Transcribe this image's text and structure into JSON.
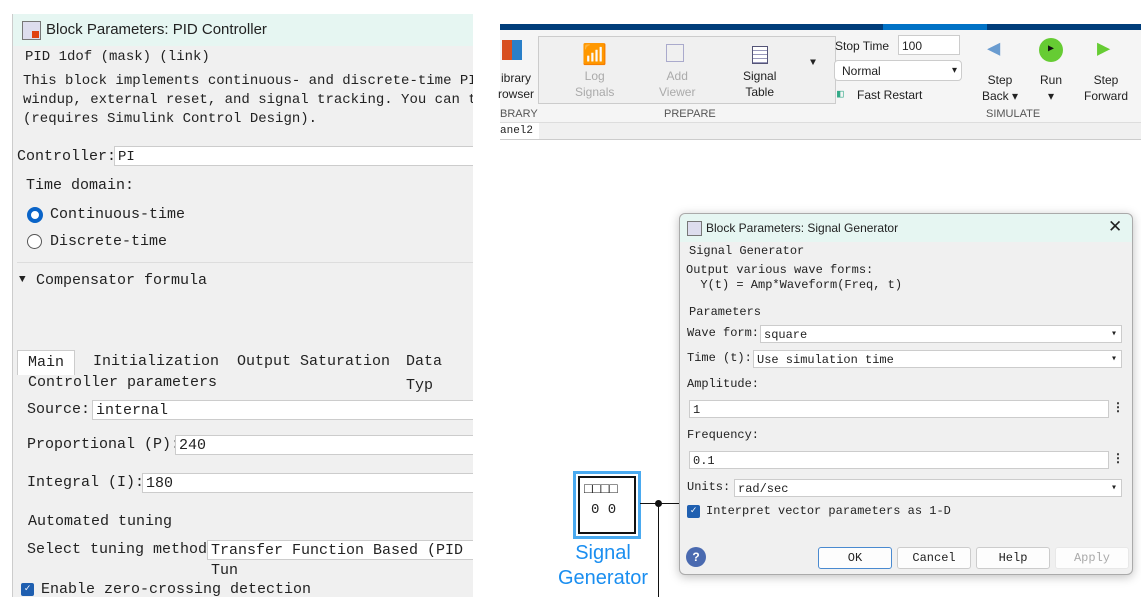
{
  "pid": {
    "title": "Block Parameters: PID Controller",
    "mask": "PID 1dof (mask) (link)",
    "desc": [
      "This block implements continuous- and discrete-time PID",
      "windup, external reset, and signal tracking. You can tu",
      "(requires Simulink Control Design)."
    ],
    "controller_label": "Controller:",
    "controller_value": "PI",
    "time_domain": "Time domain:",
    "radio_continuous": "Continuous-time",
    "radio_discrete": "Discrete-time",
    "compensator": "Compensator formula",
    "tabs": [
      "Main",
      "Initialization",
      "Output Saturation",
      "Data Typ"
    ],
    "controller_params": "Controller parameters",
    "source_label": "Source:",
    "source_value": "internal",
    "p_label": "Proportional (P):",
    "p_value": "240",
    "i_label": "Integral (I):",
    "i_value": "180",
    "auto_tuning": "Automated tuning",
    "tuning_label": "Select tuning method:",
    "tuning_value": "Transfer Function Based (PID Tun",
    "zero_crossing": "Enable zero-crossing detection"
  },
  "ribbon": {
    "library": [
      "ibrary",
      "rowser"
    ],
    "library_section": "BRARY",
    "log": [
      "Log",
      "Signals"
    ],
    "viewer": [
      "Add",
      "Viewer"
    ],
    "table": [
      "Signal",
      "Table"
    ],
    "prepare": "PREPARE",
    "stop_time_label": "Stop Time",
    "stop_time": "100",
    "mode": "Normal",
    "fast_restart": "Fast Restart",
    "step_back": [
      "Step",
      "Back"
    ],
    "run": "Run",
    "step_forward": [
      "Step",
      "Forward"
    ],
    "simulate": "SIMULATE",
    "tab": "anel2"
  },
  "block": {
    "label": [
      "Signal",
      "Generator"
    ],
    "icon_text": [
      "□□□□",
      "0 0"
    ]
  },
  "sg": {
    "title": "Block Parameters: Signal Generator",
    "section": "Signal Generator",
    "desc": [
      "Output various wave forms:",
      "  Y(t) = Amp*Waveform(Freq, t)"
    ],
    "params": "Parameters",
    "wave_label": "Wave form:",
    "wave": "square",
    "time_label": "Time (t):",
    "time": "Use simulation time",
    "amp_label": "Amplitude:",
    "amp": "1",
    "freq_label": "Frequency:",
    "freq": "0.1",
    "units_label": "Units:",
    "units": "rad/sec",
    "interpret": "Interpret vector parameters as 1-D",
    "ok": "OK",
    "cancel": "Cancel",
    "help": "Help",
    "apply": "Apply"
  }
}
